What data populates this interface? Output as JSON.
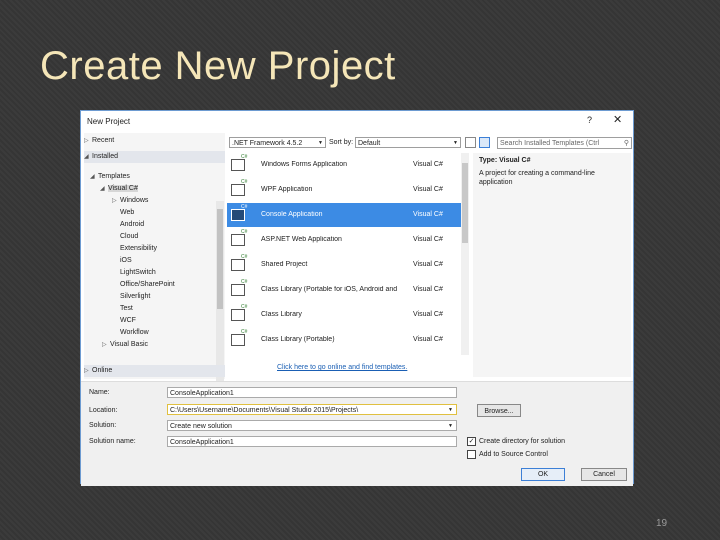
{
  "slide": {
    "title": "Create New Project",
    "page_number": "19"
  },
  "dialog": {
    "title": "New Project",
    "help": "?",
    "close": "✕",
    "tree": {
      "recent": "Recent",
      "installed": "Installed",
      "templates": "Templates",
      "visual_csharp": "Visual C#",
      "windows": "Windows",
      "children": [
        "Web",
        "Android",
        "Cloud",
        "Extensibility",
        "iOS",
        "LightSwitch",
        "Office/SharePoint",
        "Silverlight",
        "Test",
        "WCF",
        "Workflow"
      ],
      "visual_basic": "Visual Basic",
      "online": "Online"
    },
    "toolbar": {
      "framework": ".NET Framework 4.5.2",
      "sort_label": "Sort by:",
      "sort_value": "Default",
      "search_placeholder": "Search Installed Templates (Ctrl"
    },
    "templates": [
      {
        "name": "Windows Forms Application",
        "lang": "Visual C#"
      },
      {
        "name": "WPF Application",
        "lang": "Visual C#"
      },
      {
        "name": "Console Application",
        "lang": "Visual C#"
      },
      {
        "name": "ASP.NET Web Application",
        "lang": "Visual C#"
      },
      {
        "name": "Shared Project",
        "lang": "Visual C#"
      },
      {
        "name": "Class Library (Portable for iOS, Android and",
        "lang": "Visual C#"
      },
      {
        "name": "Class Library",
        "lang": "Visual C#"
      },
      {
        "name": "Class Library (Portable)",
        "lang": "Visual C#"
      }
    ],
    "selected_index": 2,
    "online_link": "Click here to go online and find templates.",
    "details": {
      "type": "Type:  Visual C#",
      "description": "A project for creating a command-line application"
    },
    "form": {
      "name_label": "Name:",
      "name_value": "ConsoleApplication1",
      "location_label": "Location:",
      "location_value": "C:\\Users\\Username\\Documents\\Visual Studio 2015\\Projects\\",
      "solution_label": "Solution:",
      "solution_value": "Create new solution",
      "solution_name_label": "Solution name:",
      "solution_name_value": "ConsoleApplication1",
      "browse": "Browse...",
      "create_dir": "Create directory for solution",
      "create_dir_checked": true,
      "add_source_control": "Add to Source Control",
      "add_source_control_checked": false,
      "ok": "OK",
      "cancel": "Cancel"
    }
  }
}
